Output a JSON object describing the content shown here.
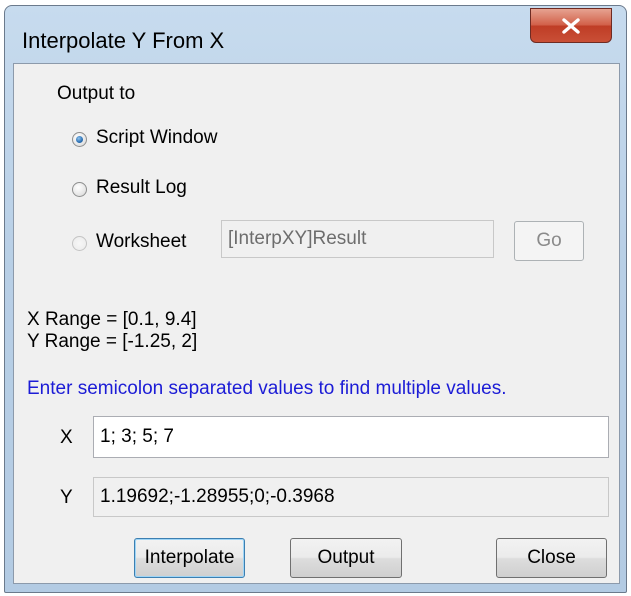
{
  "window": {
    "title": "Interpolate Y From X"
  },
  "output": {
    "group_label": "Output to",
    "options": [
      {
        "label": "Script Window",
        "selected": true,
        "enabled": true
      },
      {
        "label": "Result Log",
        "selected": false,
        "enabled": true
      },
      {
        "label": "Worksheet",
        "selected": false,
        "enabled": false
      }
    ],
    "worksheet_value": "[InterpXY]Result",
    "go_label": "Go"
  },
  "ranges": {
    "x_range": "X Range = [0.1, 9.4]",
    "y_range": "Y Range = [-1.25, 2]"
  },
  "hint": "Enter semicolon separated values to find multiple values.",
  "inputs": {
    "x_label": "X",
    "x_value": "1; 3; 5; 7",
    "y_label": "Y",
    "y_value": "1.19692;-1.28955;0;-0.3968"
  },
  "buttons": {
    "interpolate": "Interpolate",
    "output": "Output",
    "close": "Close"
  },
  "colors": {
    "hint_text": "#1c1cd6",
    "close_button": "#c94f36"
  }
}
